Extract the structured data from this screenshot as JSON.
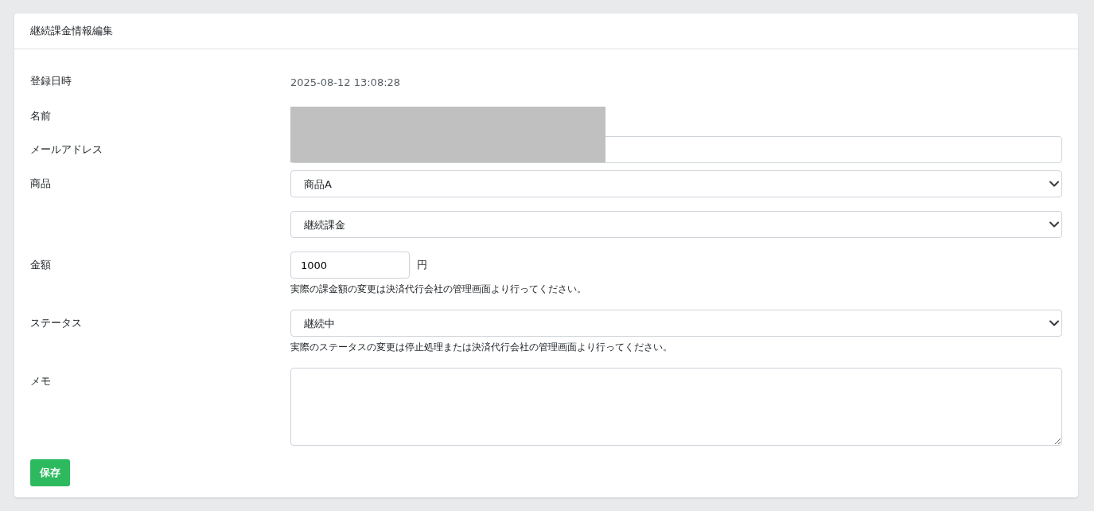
{
  "card": {
    "title": "継続課金情報編集"
  },
  "fields": [
    {
      "kind": "text",
      "label": "登録日時",
      "value": "2025-08-12 13:08:28"
    },
    {
      "kind": "blank",
      "label": "名前"
    },
    {
      "kind": "input",
      "label": "メールアドレス"
    },
    {
      "kind": "select",
      "label": "商品",
      "value": "商品A"
    },
    {
      "kind": "select",
      "value": "継続課金"
    },
    {
      "kind": "amount",
      "label": "金額",
      "value": "1000",
      "unit": "円",
      "help": "実際の課金額の変更は決済代行会社の管理画面より行ってください。"
    },
    {
      "kind": "select",
      "label": "ステータス",
      "value": "継続中",
      "help": "実際のステータスの変更は停止処理または決済代行会社の管理画面より行ってください。"
    },
    {
      "kind": "textarea",
      "label": "メモ"
    }
  ],
  "save_button": "保存"
}
